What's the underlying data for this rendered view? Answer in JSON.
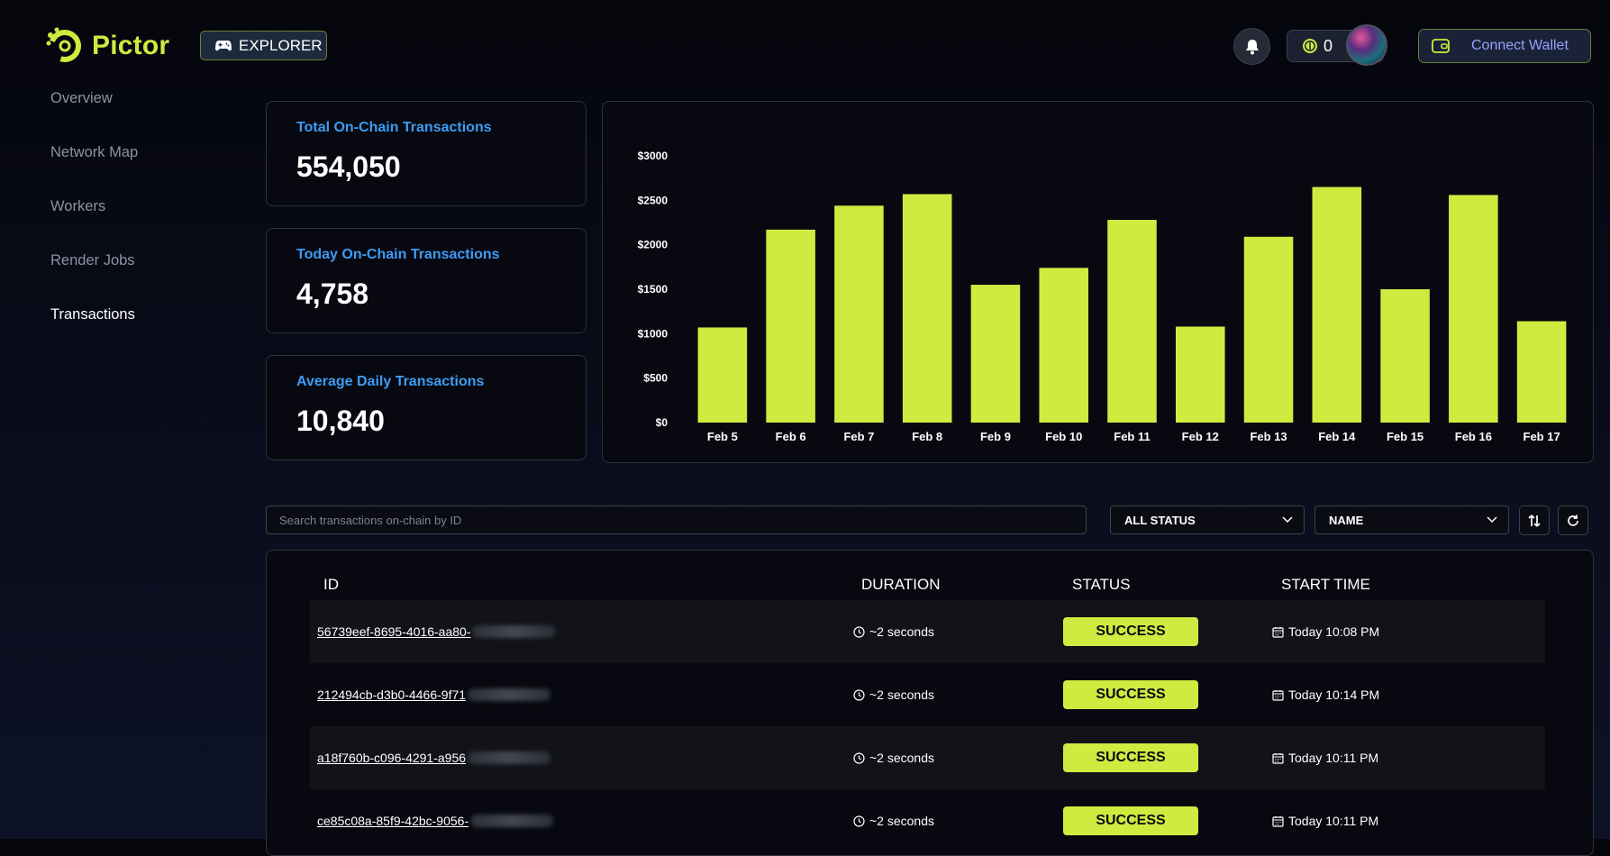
{
  "brand": {
    "name": "Pictor",
    "accent": "#d0ea40",
    "link_blue": "#3c9cf4"
  },
  "header": {
    "explorer_label": "EXPLORER",
    "balance": "0",
    "wallet_label": "Connect Wallet"
  },
  "sidebar": {
    "items": [
      {
        "label": "Overview",
        "active": false
      },
      {
        "label": "Network Map",
        "active": false
      },
      {
        "label": "Workers",
        "active": false
      },
      {
        "label": "Render Jobs",
        "active": false
      },
      {
        "label": "Transactions",
        "active": true
      }
    ]
  },
  "stats": [
    {
      "title": "Total On-Chain Transactions",
      "value": "554,050"
    },
    {
      "title": "Today On-Chain Transactions",
      "value": "4,758"
    },
    {
      "title": "Average Daily Transactions",
      "value": "10,840"
    }
  ],
  "chart_data": {
    "type": "bar",
    "categories": [
      "Feb 5",
      "Feb 6",
      "Feb 7",
      "Feb 8",
      "Feb 9",
      "Feb 10",
      "Feb 11",
      "Feb 12",
      "Feb 13",
      "Feb 14",
      "Feb 15",
      "Feb 16",
      "Feb 17"
    ],
    "values": [
      1070,
      2170,
      2440,
      2570,
      1550,
      1740,
      2280,
      1080,
      2090,
      2650,
      1500,
      2560,
      1140
    ],
    "ylim": [
      0,
      3000
    ],
    "yticks": [
      0,
      500,
      1000,
      1500,
      2000,
      2500,
      3000
    ],
    "ytick_labels": [
      "$0",
      "$500",
      "$1000",
      "$1500",
      "$2000",
      "$2500",
      "$3000"
    ],
    "bar_color": "#d0ea40",
    "grid": false
  },
  "filters": {
    "search_placeholder": "Search transactions on-chain by ID",
    "status_value": "ALL STATUS",
    "sort_value": "NAME"
  },
  "table": {
    "headers": {
      "id": "ID",
      "duration": "DURATION",
      "status": "STATUS",
      "start": "START TIME"
    },
    "rows": [
      {
        "id": "56739eef-8695-4016-aa80-",
        "duration": "~2 seconds",
        "status": "SUCCESS",
        "start": "Today 10:08 PM"
      },
      {
        "id": "212494cb-d3b0-4466-9f71",
        "duration": "~2 seconds",
        "status": "SUCCESS",
        "start": "Today 10:14 PM"
      },
      {
        "id": "a18f760b-c096-4291-a956",
        "duration": "~2 seconds",
        "status": "SUCCESS",
        "start": "Today 10:11 PM"
      },
      {
        "id": "ce85c08a-85f9-42bc-9056-",
        "duration": "~2 seconds",
        "status": "SUCCESS",
        "start": "Today 10:11 PM"
      }
    ]
  }
}
